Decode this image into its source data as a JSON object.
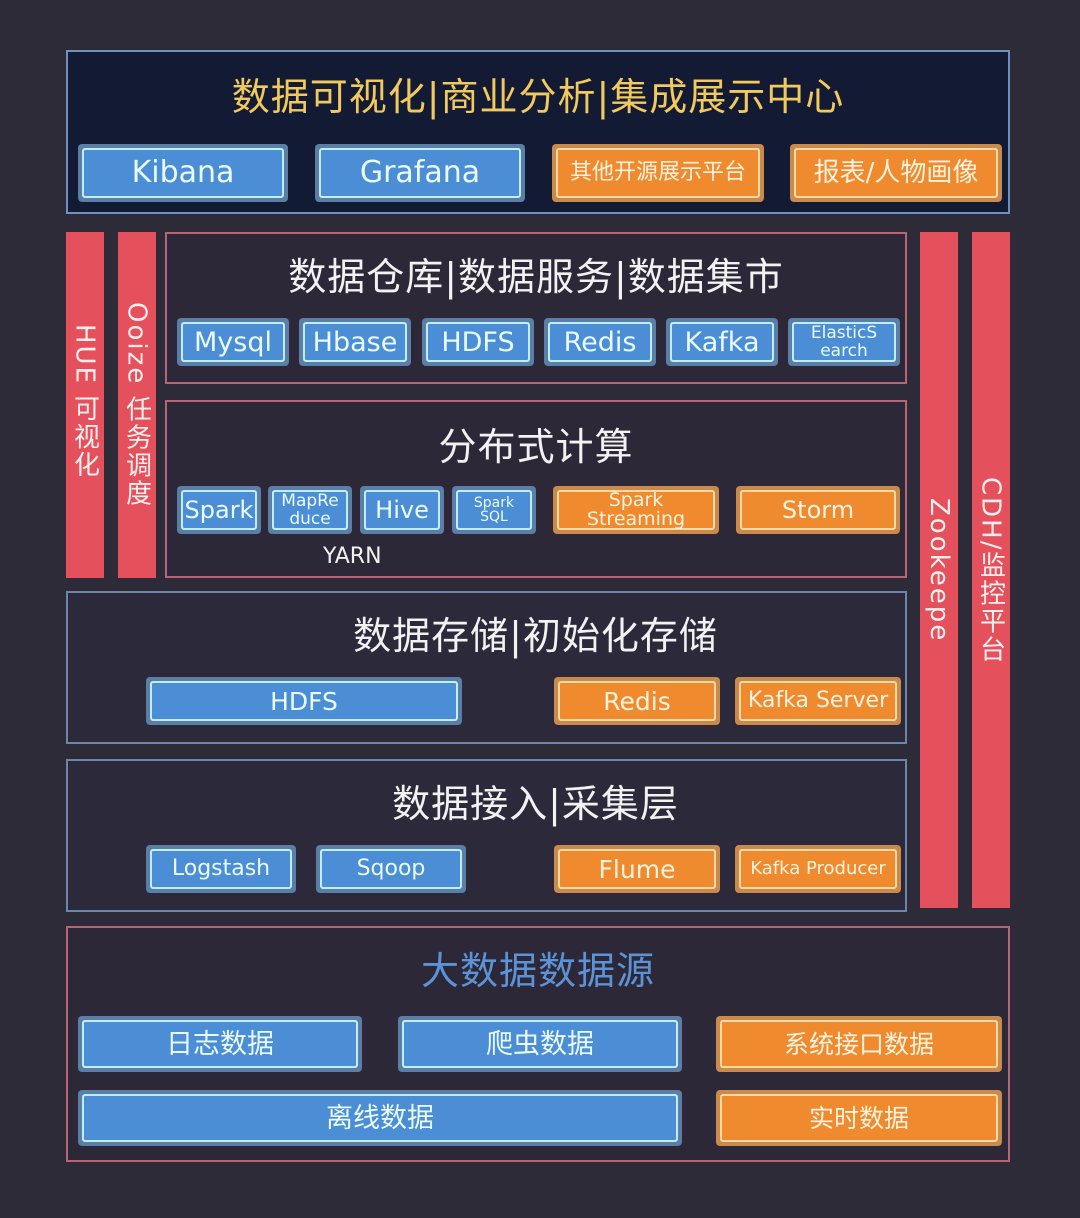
{
  "visualization": {
    "title": "数据可视化|商业分析|集成展示中心",
    "items": [
      {
        "label": "Kibana",
        "color": "blue"
      },
      {
        "label": "Grafana",
        "color": "blue"
      },
      {
        "label": "其他开源展示平台",
        "color": "orange"
      },
      {
        "label": "报表/人物画像",
        "color": "orange"
      }
    ]
  },
  "side_bars": {
    "hue": "HUE 可视化",
    "oozie": "Ooize 任务调度",
    "zookeeper": "Zookeepe",
    "cdh": "CDH/监控平台"
  },
  "warehouse": {
    "title": "数据仓库|数据服务|数据集市",
    "items": [
      {
        "label": "Mysql",
        "color": "blue"
      },
      {
        "label": "Hbase",
        "color": "blue"
      },
      {
        "label": "HDFS",
        "color": "blue"
      },
      {
        "label": "Redis",
        "color": "blue"
      },
      {
        "label": "Kafka",
        "color": "blue"
      },
      {
        "label_line1": "ElasticS",
        "label_line2": "earch",
        "color": "blue"
      }
    ]
  },
  "compute": {
    "title": "分布式计算",
    "items": [
      {
        "label": "Spark",
        "color": "blue"
      },
      {
        "label_line1": "MapRe",
        "label_line2": "duce",
        "color": "blue"
      },
      {
        "label": "Hive",
        "color": "blue"
      },
      {
        "label": "Spark SQL",
        "color": "blue"
      },
      {
        "label": "Spark Streaming",
        "color": "orange"
      },
      {
        "label": "Storm",
        "color": "orange"
      }
    ],
    "yarn_label": "YARN"
  },
  "storage": {
    "title": "数据存储|初始化存储",
    "items": [
      {
        "label": "HDFS",
        "color": "blue"
      },
      {
        "label": "Redis",
        "color": "orange"
      },
      {
        "label": "Kafka Server",
        "color": "orange"
      }
    ]
  },
  "ingestion": {
    "title": "数据接入|采集层",
    "items": [
      {
        "label": "Logstash",
        "color": "blue"
      },
      {
        "label": "Sqoop",
        "color": "blue"
      },
      {
        "label": "Flume",
        "color": "orange"
      },
      {
        "label": "Kafka Producer",
        "color": "orange"
      }
    ]
  },
  "sources": {
    "title": "大数据数据源",
    "items": [
      {
        "label": "日志数据",
        "color": "blue"
      },
      {
        "label": "爬虫数据",
        "color": "blue"
      },
      {
        "label": "系统接口数据",
        "color": "orange"
      },
      {
        "label": "离线数据",
        "color": "blue"
      },
      {
        "label": "实时数据",
        "color": "orange"
      }
    ]
  },
  "colors": {
    "background": "#2e2b38",
    "blue_box": "#4b8ed5",
    "orange_box": "#f08a2e",
    "side_bar_red": "#e4505c",
    "gold_title": "#f2c95c",
    "blue_title": "#5d93d6"
  }
}
